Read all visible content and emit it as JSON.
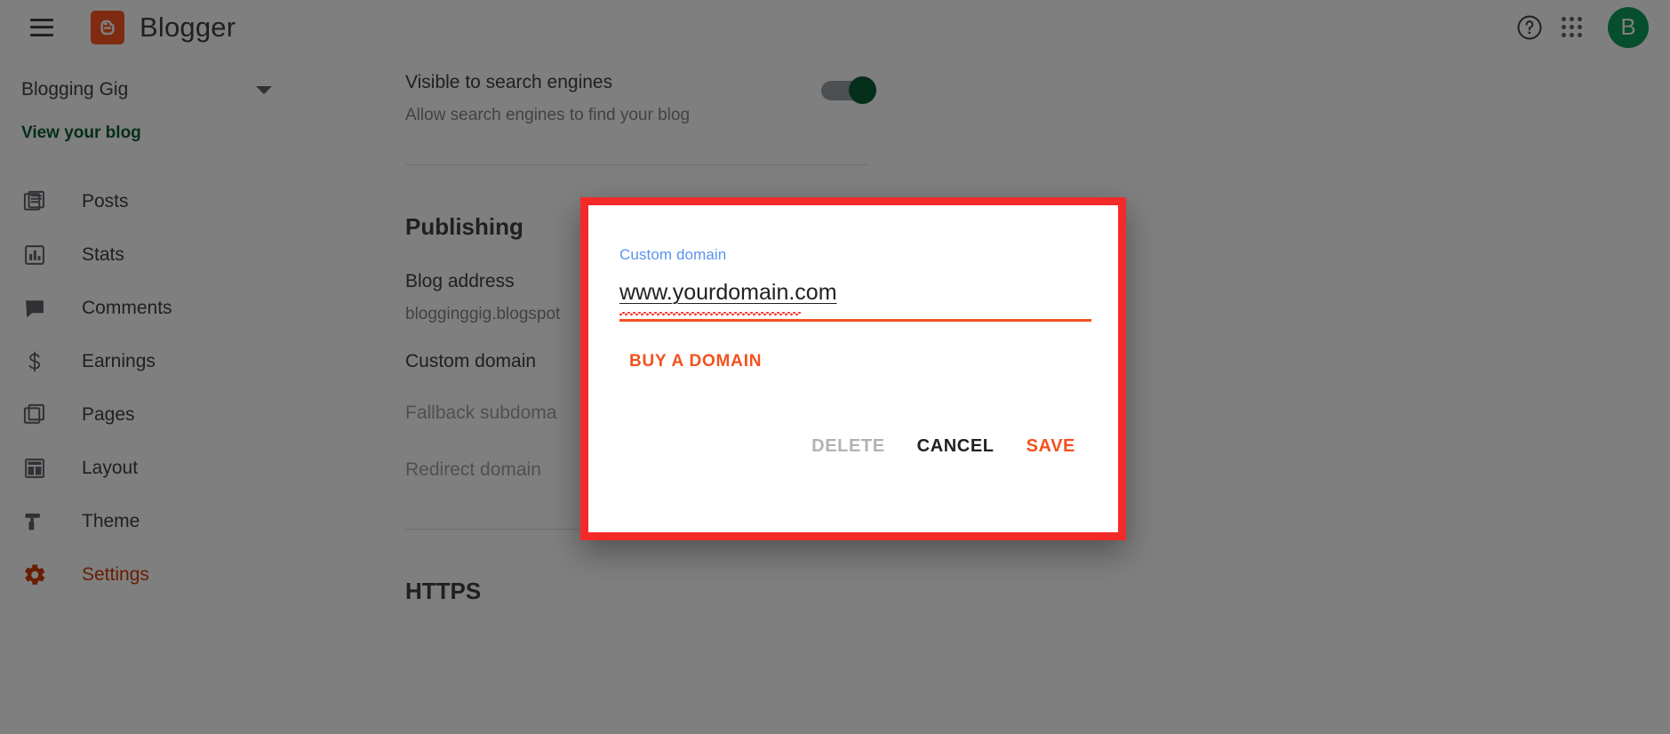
{
  "topbar": {
    "menu_icon": "hamburger-menu-icon",
    "brand_name": "Blogger",
    "brand_logo_icon": "blogger-logo-icon",
    "help_icon": "help-circle-icon",
    "apps_icon": "apps-grid-icon",
    "avatar_initial": "B",
    "avatar_color": "#0f9d58"
  },
  "sidebar": {
    "blog_name": "Blogging Gig",
    "blog_selector_icon": "chevron-down-icon",
    "view_blog_label": "View your blog",
    "items": [
      {
        "label": "Posts",
        "icon": "posts-icon",
        "active": false
      },
      {
        "label": "Stats",
        "icon": "stats-icon",
        "active": false
      },
      {
        "label": "Comments",
        "icon": "comments-icon",
        "active": false
      },
      {
        "label": "Earnings",
        "icon": "earnings-icon",
        "active": false
      },
      {
        "label": "Pages",
        "icon": "pages-icon",
        "active": false
      },
      {
        "label": "Layout",
        "icon": "layout-icon",
        "active": false
      },
      {
        "label": "Theme",
        "icon": "theme-icon",
        "active": false
      },
      {
        "label": "Settings",
        "icon": "settings-gear-icon",
        "active": true
      }
    ],
    "active_color": "#cc3e06"
  },
  "main": {
    "search_visibility": {
      "title": "Visible to search engines",
      "subtitle": "Allow search engines to find your blog",
      "toggle_state": "on",
      "toggle_on_color": "#0b5c36"
    },
    "publishing": {
      "heading": "Publishing",
      "blog_address_label": "Blog address",
      "blog_address_value": "blogginggig.blogspot",
      "custom_domain_label": "Custom domain",
      "fallback_subdomain_label": "Fallback subdoma",
      "redirect_domain_label": "Redirect domain"
    },
    "https": {
      "heading": "HTTPS"
    }
  },
  "modal": {
    "highlight_color": "#f42a2a",
    "field_label": "Custom domain",
    "field_value": "www.yourdomain.com",
    "field_placeholder": "www.yourdomain.com",
    "underline_color": "#f4511e",
    "buy_domain_label": "BUY A DOMAIN",
    "buttons": {
      "delete": "DELETE",
      "cancel": "CANCEL",
      "save": "SAVE"
    },
    "button_colors": {
      "delete": "#b0b3b6",
      "cancel": "#202124",
      "save": "#f4511e"
    }
  }
}
